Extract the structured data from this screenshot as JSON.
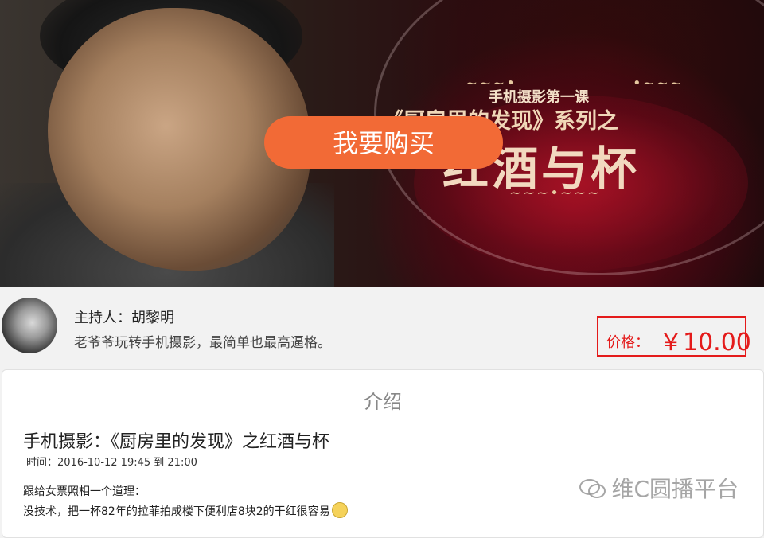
{
  "hero": {
    "kicker": "手机摄影第一课",
    "series": "《厨房里的发现》系列之",
    "headline": "红酒与杯",
    "buy_button": "我要购买"
  },
  "host": {
    "name_line": "主持人：胡黎明",
    "description": "老爷爷玩转手机摄影，最简单也最高逼格。"
  },
  "price": {
    "label": "价格：",
    "value": "￥10.00"
  },
  "intro": {
    "heading": "介绍",
    "title": "手机摄影：《厨房里的发现》之红酒与杯",
    "time": "时间：2016-10-12 19:45 到 21:00",
    "lines": [
      "跟给女票照相一个道理：",
      "没技术，把一杯82年的拉菲拍成楼下便利店8块2的干红很容易"
    ]
  },
  "watermark": "维C圆播平台"
}
